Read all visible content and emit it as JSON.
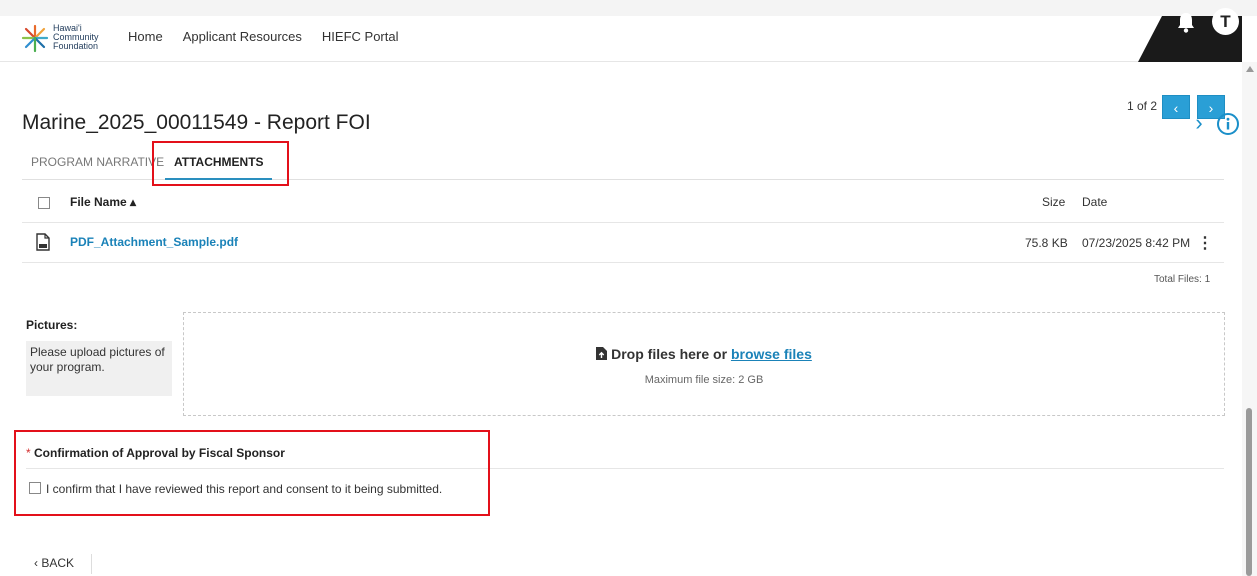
{
  "header": {
    "logo_text": [
      "Hawai'i",
      "Community",
      "Foundation"
    ],
    "nav": [
      "Home",
      "Applicant Resources",
      "HIEFC Portal"
    ],
    "avatar_initial": "T",
    "icons": {
      "notifications": "bell-icon"
    }
  },
  "pager": {
    "text": "1 of 2",
    "prev": "‹",
    "next": "›"
  },
  "page": {
    "title": "Marine_2025_00011549 - Report FOI",
    "next_icon": "›",
    "info_icon": "info-icon"
  },
  "tabs": [
    {
      "label": "PROGRAM NARRATIVE",
      "active": false
    },
    {
      "label": "ATTACHMENTS",
      "active": true
    }
  ],
  "attachments": {
    "columns": {
      "name": "File Name ▴",
      "size": "Size",
      "date": "Date"
    },
    "rows": [
      {
        "name": "PDF_Attachment_Sample.pdf",
        "size": "75.8 KB",
        "date": "07/23/2025 8:42 PM",
        "icon": "pdf-file-icon"
      }
    ],
    "total": "Total Files: 1"
  },
  "pictures": {
    "label": "Pictures:",
    "help": "Please upload pictures of your program.",
    "drop_prefix": "Drop files here or ",
    "drop_link": "browse files",
    "max_size": "Maximum file size: 2 GB"
  },
  "confirmation": {
    "required_mark": "*",
    "title": "Confirmation of Approval by Fiscal Sponsor",
    "checkbox_label": "I confirm that I have reviewed this report and consent to it being submitted.",
    "checked": false
  },
  "footer": {
    "back": "‹ BACK"
  },
  "colors": {
    "accent": "#2a9fd6",
    "link": "#1a82b8",
    "annotation": "#e3101a",
    "header_dark": "#1a1a1a"
  }
}
